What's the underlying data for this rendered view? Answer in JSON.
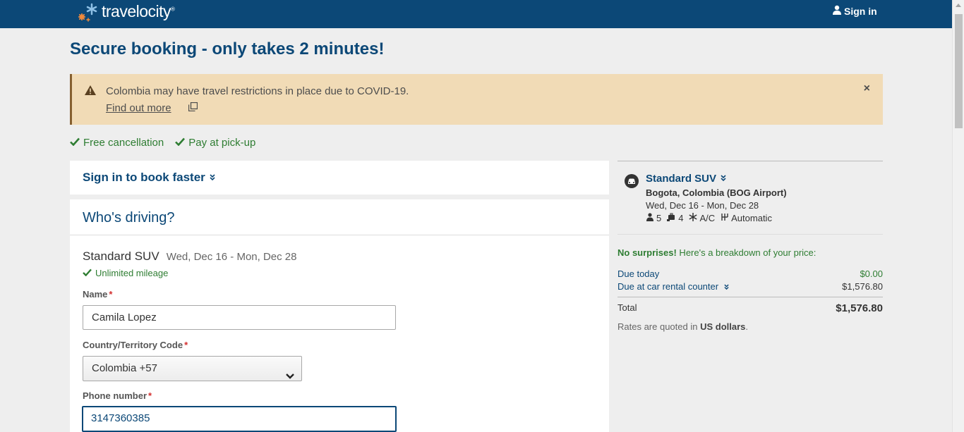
{
  "header": {
    "brand": "travelocity",
    "brand_tm": "®",
    "sign_in": "Sign in",
    "bg_color": "#0c4877"
  },
  "page": {
    "title": "Secure booking - only takes 2 minutes!"
  },
  "alert": {
    "message": "Colombia may have travel restrictions in place due to COVID-19.",
    "link": "Find out more",
    "close": "×"
  },
  "perks": [
    {
      "label": "Free cancellation",
      "icon": "check-icon"
    },
    {
      "label": "Pay at pick-up",
      "icon": "check-icon"
    }
  ],
  "signin_card": {
    "label": "Sign in to book faster"
  },
  "driver": {
    "heading": "Who's driving?",
    "car": "Standard SUV",
    "dates": "Wed, Dec 16 - Mon, Dec 28",
    "mileage": "Unlimited mileage",
    "name_label": "Name",
    "name_value": "Camila Lopez",
    "country_label": "Country/Territory Code",
    "country_value": "Colombia +57",
    "phone_label": "Phone number",
    "phone_value": "3147360385",
    "required_mark": "*"
  },
  "summary": {
    "car": "Standard SUV",
    "location": "Bogota, Colombia (BOG Airport)",
    "dates": "Wed, Dec 16 - Mon, Dec 28",
    "specs": {
      "passengers": "5",
      "bags": "4",
      "ac": "A/C",
      "transmission": "Automatic"
    },
    "no_surprises_bold": "No surprises!",
    "no_surprises_rest": " Here's a breakdown of your price:",
    "due_today_label": "Due today",
    "due_today_value": "$0.00",
    "due_counter_label": "Due at car rental counter",
    "due_counter_value": "$1,576.80",
    "total_label": "Total",
    "total_value": "$1,576.80",
    "rates_prefix": "Rates are quoted in ",
    "rates_currency": "US dollars",
    "rates_suffix": "."
  },
  "colors": {
    "brand_blue": "#0c4877",
    "success_green": "#2e7d32",
    "alert_bg": "#f1dbb6",
    "required_red": "#d32f2f"
  }
}
